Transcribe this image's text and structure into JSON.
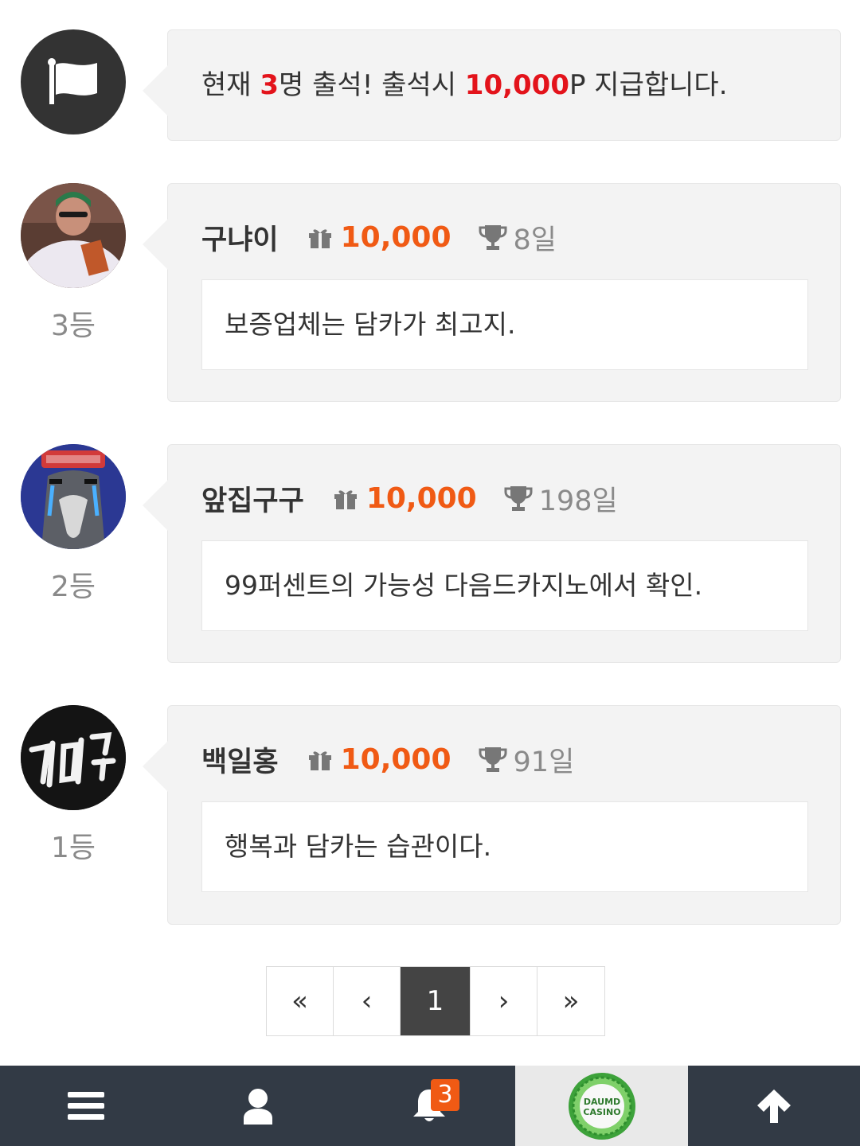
{
  "notice": {
    "prefix": "현재 ",
    "count": "3",
    "middle": "명 출석! 출석시 ",
    "points": "10,000",
    "suffix": "P 지급합니다."
  },
  "entries": [
    {
      "rank": "3등",
      "nickname": "구냐이",
      "points": "10,000",
      "days": "8일",
      "comment": "보증업체는 담카가 최고지."
    },
    {
      "rank": "2등",
      "nickname": "앞집구구",
      "points": "10,000",
      "days": "198일",
      "comment": "99퍼센트의 가능성 다음드카지노에서 확인."
    },
    {
      "rank": "1등",
      "nickname": "백일홍",
      "points": "10,000",
      "days": "91일",
      "comment": "행복과 담카는 습관이다."
    }
  ],
  "avatar_images": {
    "entry_0": "man-with-green-cap",
    "entry_1": "crying-penguin-avatar",
    "entry_2": "neon-sign-avatar"
  },
  "pagination": {
    "first": "«",
    "prev": "‹",
    "current": "1",
    "next": "›",
    "last": "»"
  },
  "bottom_bar": {
    "notification_count": "3",
    "logo_text_1": "DAUMD",
    "logo_text_2": "CASINO"
  },
  "colors": {
    "points_orange": "#f05a14",
    "notice_red": "#e3131b",
    "bar_background": "#323a45",
    "active_page": "#444444"
  }
}
